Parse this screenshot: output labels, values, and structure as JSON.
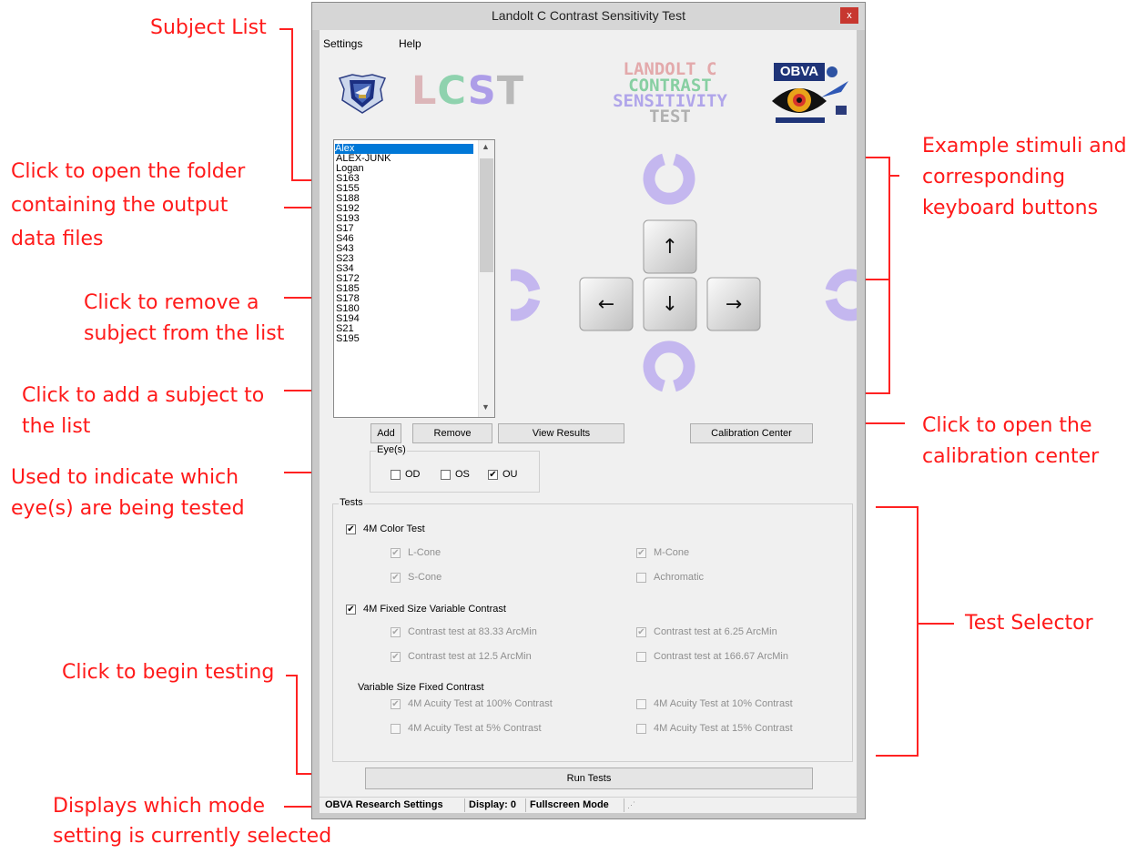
{
  "window": {
    "title": "Landolt C Contrast Sensitivity Test",
    "close_glyph": "x"
  },
  "menu": {
    "settings": "Settings",
    "help": "Help"
  },
  "logos": {
    "lcst": [
      "L",
      "C",
      "S",
      "T"
    ],
    "landolt_c": "LANDOLT C",
    "contrast": "CONTRAST",
    "sensitivity": "SENSITIVITY",
    "test": "TEST",
    "obva": "OBVA",
    "colors": {
      "landolt": "#e3a9ab",
      "contrast": "#87cfa2",
      "sensitivity": "#b0a5ea",
      "test": "#b0b0b0"
    }
  },
  "subjects": [
    "Alex",
    "ALEX-JUNK",
    "Logan",
    "S163",
    "S155",
    "S188",
    "S192",
    "S193",
    "S17",
    "S46",
    "S43",
    "S23",
    "S34",
    "S172",
    "S185",
    "S178",
    "S180",
    "S194",
    "S21",
    "S195"
  ],
  "stimuli": {
    "c_color": "#c4b7ef",
    "keys": {
      "up": "↑",
      "left": "←",
      "down": "↓",
      "right": "→"
    }
  },
  "buttons": {
    "add": "Add",
    "remove": "Remove",
    "view_results": "View Results",
    "calibration_center": "Calibration Center",
    "run_tests": "Run Tests"
  },
  "eyes": {
    "label": "Eye(s)",
    "od": {
      "label": "OD",
      "checked": false
    },
    "os": {
      "label": "OS",
      "checked": false
    },
    "ou": {
      "label": "OU",
      "checked": true
    }
  },
  "tests": {
    "label": "Tests",
    "color_test": {
      "label": "4M Color Test",
      "checked": true,
      "l_cone": "L-Cone",
      "m_cone": "M-Cone",
      "s_cone": "S-Cone",
      "achromatic": "Achromatic"
    },
    "fixed_size": {
      "label": "4M Fixed Size Variable Contrast",
      "checked": true,
      "c1": "Contrast test at 83.33 ArcMin",
      "c2": "Contrast test at 6.25 ArcMin",
      "c3": "Contrast test at 12.5 ArcMin",
      "c4": "Contrast test at 166.67 ArcMin"
    },
    "variable_size": {
      "label": "Variable Size Fixed Contrast",
      "a1": "4M Acuity Test at 100% Contrast",
      "a2": "4M Acuity Test at 10% Contrast",
      "a3": "4M Acuity Test at 5% Contrast",
      "a4": "4M Acuity Test at 15% Contrast"
    }
  },
  "status": {
    "mode": "OBVA Research Settings",
    "display": "Display: 0",
    "screen": "Fullscreen Mode"
  },
  "annotations": {
    "subject_list": "Subject List",
    "open_folder": [
      "Click to open the folder",
      "containing the output",
      "data files"
    ],
    "remove": [
      "Click to remove a",
      "subject from the list"
    ],
    "add": [
      "Click to add a subject to",
      "the list"
    ],
    "eyes": [
      "Used to indicate which",
      "eye(s) are being tested"
    ],
    "begin": "Click to begin testing",
    "mode": [
      "Displays which mode",
      "setting is currently selected"
    ],
    "stimuli": [
      "Example stimuli and",
      "corresponding",
      "keyboard buttons"
    ],
    "calibration": [
      "Click to open the",
      "calibration center"
    ],
    "test_selector": "Test Selector"
  }
}
